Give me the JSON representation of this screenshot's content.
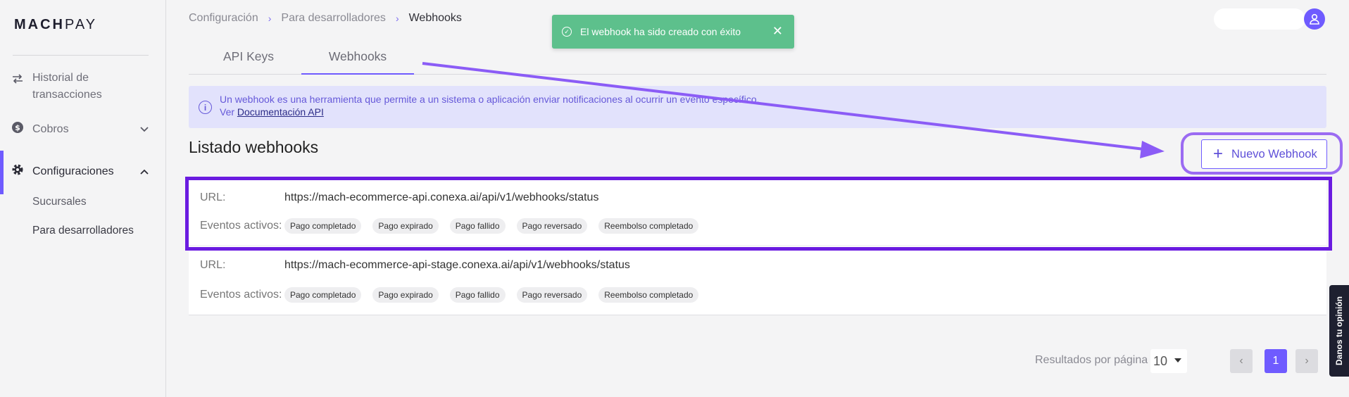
{
  "app": {
    "logo_prefix": "MACH",
    "logo_suffix": "PAY"
  },
  "sidebar": {
    "items": [
      {
        "label_line1": "Historial de",
        "label_line2": "transacciones",
        "icon": "swap-arrows-icon"
      },
      {
        "label": "Cobros",
        "icon": "dollar-circle-icon"
      },
      {
        "label": "Configuraciones",
        "icon": "gear-icon"
      }
    ],
    "subitems": [
      "Sucursales",
      "Para desarrolladores"
    ]
  },
  "breadcrumb": {
    "items": [
      "Configuración",
      "Para desarrolladores",
      "Webhooks"
    ],
    "sep": "›"
  },
  "tabs": [
    "API Keys",
    "Webhooks"
  ],
  "toast": {
    "message": "El webhook ha sido creado con éxito",
    "close": "✕"
  },
  "info": {
    "text": "Un webhook es una herramienta que permite a un sistema o aplicación enviar notificaciones al ocurrir un evento específico.",
    "see": "Ver",
    "link": "Documentación API"
  },
  "list": {
    "title": "Listado webhooks",
    "new_button": "Nuevo Webhook"
  },
  "webhooks": [
    {
      "url_label": "URL:",
      "url": "https://mach-ecommerce-api.conexa.ai/api/v1/webhooks/status",
      "events_label": "Eventos activos:",
      "events": [
        "Pago completado",
        "Pago expirado",
        "Pago fallido",
        "Pago reversado",
        "Reembolso completado"
      ]
    },
    {
      "url_label": "URL:",
      "url": "https://mach-ecommerce-api-stage.conexa.ai/api/v1/webhooks/status",
      "events_label": "Eventos activos:",
      "events": [
        "Pago completado",
        "Pago expirado",
        "Pago fallido",
        "Pago reversado",
        "Reembolso completado"
      ]
    }
  ],
  "pagination": {
    "label": "Resultados por página",
    "per_page": "10",
    "current_page": "1",
    "prev": "‹",
    "next": "›"
  },
  "feedback": "Danos tu opinión",
  "colors": {
    "accent": "#6f5bff",
    "toast": "#5dc08c",
    "highlight": "#6a1be0",
    "annotation_arrow": "#8b5cf6"
  }
}
